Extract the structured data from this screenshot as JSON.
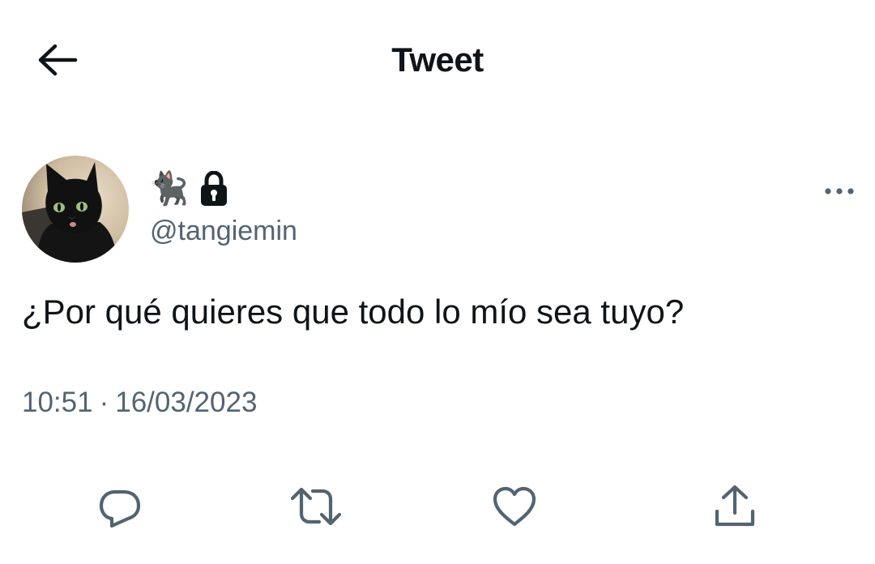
{
  "header": {
    "title": "Tweet",
    "back_icon": "arrow-left-icon"
  },
  "author": {
    "display_name": "🐈‍⬛",
    "protected_icon": "lock-icon",
    "handle": "@tangiemin",
    "avatar": "black-cat-avatar"
  },
  "tweet": {
    "text": "¿Por qué quieres que todo lo mío sea tuyo?",
    "time": "10:51",
    "separator": "·",
    "date": "16/03/2023"
  },
  "menu_icon": "more-horizontal-icon",
  "actions": [
    {
      "icon": "reply-icon"
    },
    {
      "icon": "retweet-icon"
    },
    {
      "icon": "like-icon"
    },
    {
      "icon": "share-icon"
    }
  ],
  "colors": {
    "text_primary": "#0f1419",
    "text_secondary": "#536471",
    "icon": "#536471"
  }
}
